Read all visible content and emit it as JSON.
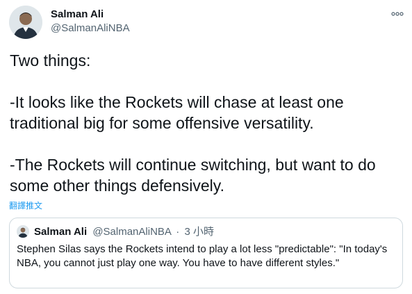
{
  "author": {
    "name": "Salman Ali",
    "handle": "@SalmanAliNBA"
  },
  "tweet": {
    "lines": [
      "Two things:",
      "-It looks like the Rockets will chase at least one traditional big for some offensive versatility.",
      "-The Rockets will continue switching, but want to do some other things defensively."
    ]
  },
  "translate_label": "翻譯推文",
  "quote": {
    "name": "Salman Ali",
    "handle": "@SalmanAliNBA",
    "separator": "·",
    "time": "3 小時",
    "text": "Stephen Silas says the Rockets intend to play a lot less \"predictable\": \"In today's NBA, you cannot just play one way. You have to have different styles.\""
  },
  "icons": {
    "more": "more-horizontal-icon",
    "avatar": "avatar-photo"
  },
  "colors": {
    "text_primary": "#0f1419",
    "text_secondary": "#536471",
    "link": "#1d9bf0",
    "border": "#cfd9de"
  }
}
